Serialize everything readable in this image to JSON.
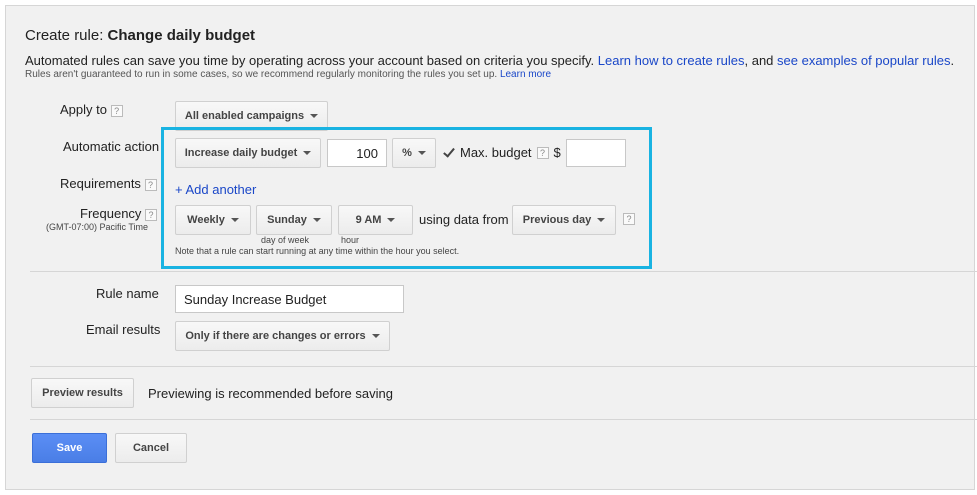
{
  "header": {
    "title_prefix": "Create rule: ",
    "title_bold": "Change daily budget",
    "description": "Automated rules can save you time by operating across your account based on criteria you specify. ",
    "link_learn_create": "Learn how to create rules",
    "description_mid": ", and see ",
    "link_examples": "see examples of popular rules",
    "description_end": ".",
    "subdescription": "Rules aren't guaranteed to run in some cases, so we recommend regularly monitoring the rules you set up. ",
    "link_learn_more": "Learn more"
  },
  "apply_to": {
    "label": "Apply to",
    "value": "All enabled campaigns"
  },
  "automatic_action": {
    "label": "Automatic action",
    "action": "Increase daily budget",
    "amount": "100",
    "unit": "%",
    "max_budget_label": "Max. budget",
    "max_budget_checked": true,
    "currency": "$",
    "max_budget_value": ""
  },
  "requirements": {
    "label": "Requirements",
    "add_another": "+ Add another"
  },
  "frequency": {
    "label": "Frequency",
    "timezone": "(GMT-07:00) Pacific Time",
    "period": "Weekly",
    "day": "Sunday",
    "day_label": "day of week",
    "hour": "9 AM",
    "hour_label": "hour",
    "using_data_from": "using data from",
    "data_range": "Previous day",
    "note": "Note that a rule can start running at any time within the hour you select."
  },
  "rule_name": {
    "label": "Rule name",
    "value": "Sunday Increase Budget"
  },
  "email_results": {
    "label": "Email results",
    "value": "Only if there are changes or errors"
  },
  "preview": {
    "button": "Preview results",
    "note": "Previewing is recommended before saving"
  },
  "footer": {
    "save": "Save",
    "cancel": "Cancel"
  },
  "colors": {
    "highlight": "#19b3e2",
    "link": "#1a47c8",
    "save": "#4a7ee6"
  },
  "icons": {
    "help": "?"
  }
}
